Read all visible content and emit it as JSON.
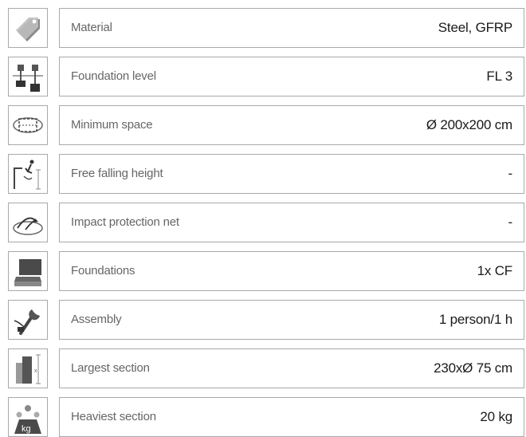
{
  "rows": [
    {
      "label": "Material",
      "value": "Steel, GFRP",
      "icon": "material-tag-icon"
    },
    {
      "label": "Foundation level",
      "value": "FL 3",
      "icon": "foundation-level-icon"
    },
    {
      "label": "Minimum space",
      "value": "Ø 200x200 cm",
      "icon": "minimum-space-icon"
    },
    {
      "label": "Free falling height",
      "value": "-",
      "icon": "free-fall-icon"
    },
    {
      "label": "Impact protection net",
      "value": "-",
      "icon": "impact-net-icon"
    },
    {
      "label": "Foundations",
      "value": "1x CF",
      "icon": "foundations-icon"
    },
    {
      "label": "Assembly",
      "value": "1 person/1 h",
      "icon": "assembly-wrench-icon"
    },
    {
      "label": "Largest section",
      "value": "230xØ 75 cm",
      "icon": "largest-section-icon"
    },
    {
      "label": "Heaviest section",
      "value": "20 kg",
      "icon": "weight-kg-icon"
    }
  ],
  "icon_text": {
    "kg": "kg"
  }
}
